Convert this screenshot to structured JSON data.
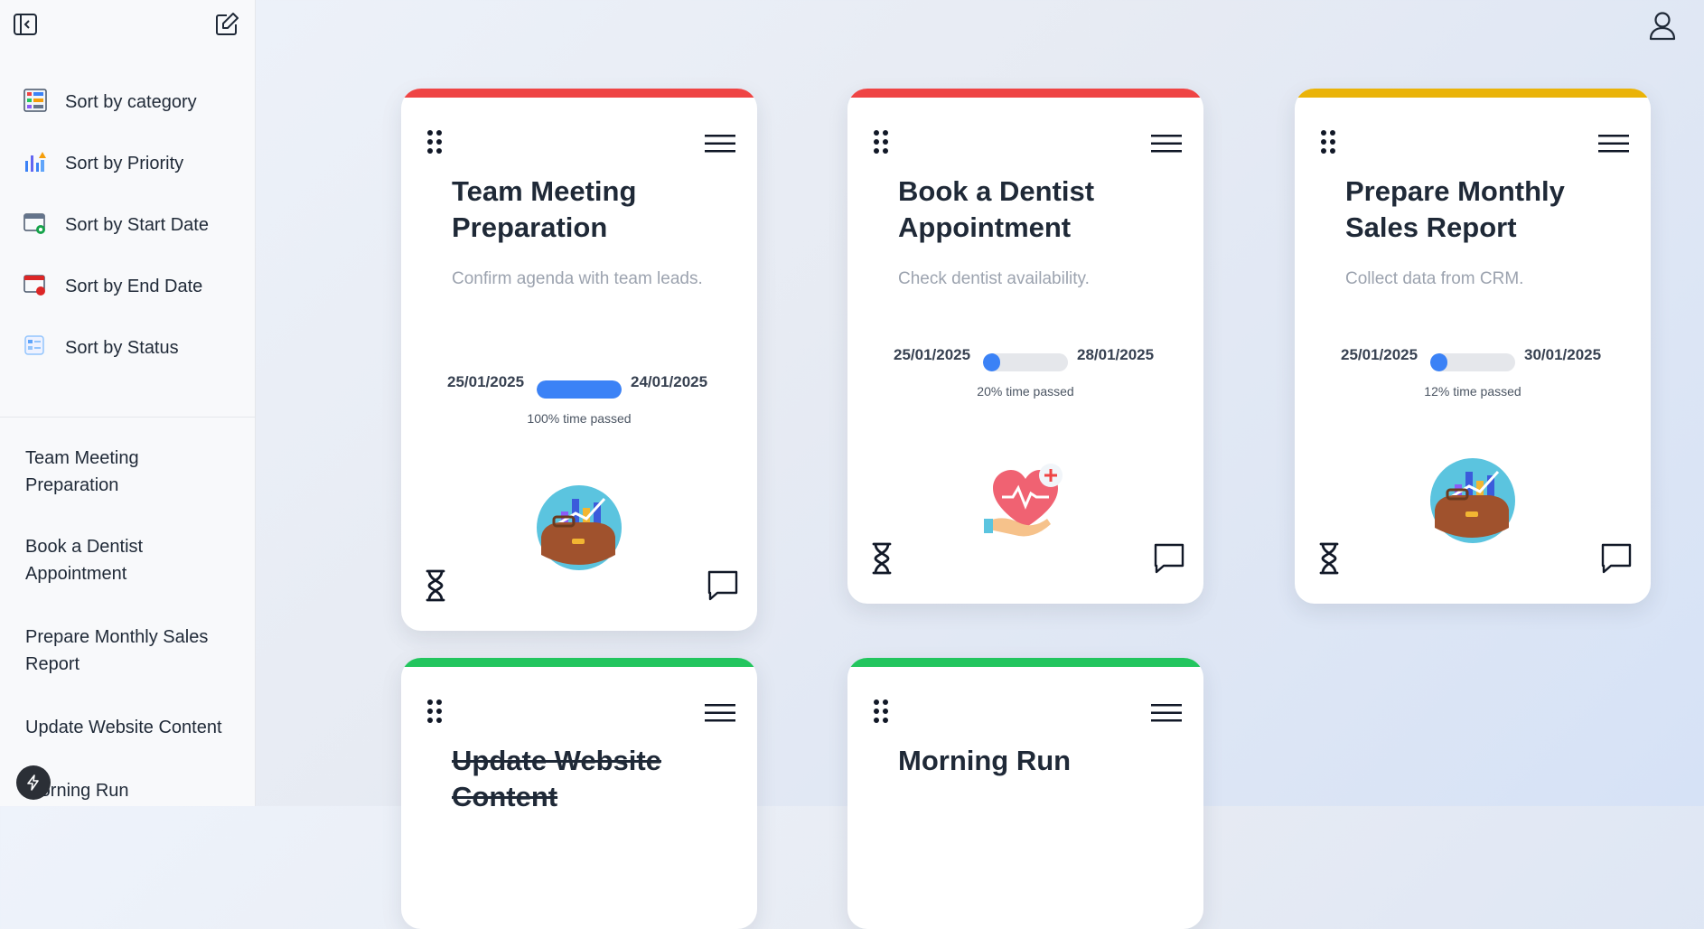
{
  "sidebar": {
    "sort_items": [
      {
        "label": "Sort by category",
        "icon": "category-sort-icon"
      },
      {
        "label": "Sort by Priority",
        "icon": "priority-sort-icon"
      },
      {
        "label": "Sort by Start Date",
        "icon": "start-date-sort-icon"
      },
      {
        "label": "Sort by End Date",
        "icon": "end-date-sort-icon"
      },
      {
        "label": "Sort by Status",
        "icon": "status-sort-icon"
      }
    ],
    "tasks": [
      "Team Meeting Preparation",
      "Book a Dentist Appointment",
      "Prepare Monthly Sales Report",
      "Update Website Content",
      "Morning Run"
    ]
  },
  "colors": {
    "high": "#ef4444",
    "medium": "#eab308",
    "low": "#22c55e",
    "progress": "#3b82f6"
  },
  "cards": [
    {
      "title": "Team Meeting Preparation",
      "description": "Confirm agenda with team leads.",
      "start_date": "25/01/2025",
      "end_date": "24/01/2025",
      "progress": 100,
      "progress_label": "100% time passed",
      "priority_color": "#ef4444",
      "illustration": "briefcase-chart-icon"
    },
    {
      "title": "Book a Dentist Appointment",
      "description": "Check dentist availability.",
      "start_date": "25/01/2025",
      "end_date": "28/01/2025",
      "progress": 20,
      "progress_label": "20% time passed",
      "priority_color": "#ef4444",
      "illustration": "health-heart-icon"
    },
    {
      "title": "Prepare Monthly Sales Report",
      "description": "Collect data from CRM.",
      "start_date": "25/01/2025",
      "end_date": "30/01/2025",
      "progress": 12,
      "progress_label": "12% time passed",
      "priority_color": "#eab308",
      "illustration": "briefcase-chart-icon"
    },
    {
      "title": "Update Website Content",
      "priority_color": "#22c55e",
      "completed": true
    },
    {
      "title": "Morning Run",
      "priority_color": "#22c55e"
    }
  ]
}
